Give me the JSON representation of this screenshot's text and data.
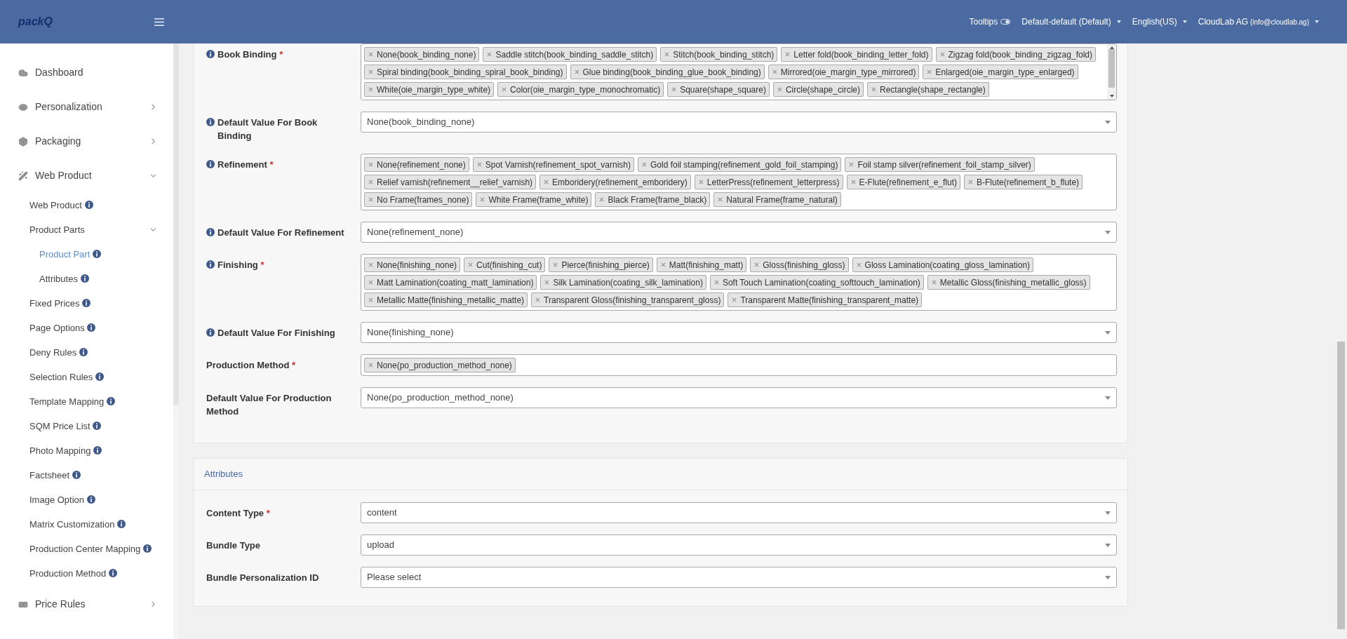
{
  "header": {
    "logo": "packQ",
    "tooltips": "Tooltips",
    "menus": [
      {
        "label": "Default-default (Default)"
      },
      {
        "label": "English(US)"
      },
      {
        "label": "CloudLab AG",
        "note": "(info@cloudlab.ag)"
      }
    ]
  },
  "sidebar": {
    "items": [
      {
        "label": "Dashboard"
      },
      {
        "label": "Personalization",
        "expanded": false
      },
      {
        "label": "Packaging",
        "expanded": false
      },
      {
        "label": "Web Product",
        "expanded": true,
        "children": [
          {
            "label": "Web Product",
            "selected": false
          },
          {
            "label": "Product Parts",
            "expanded": true,
            "children": [
              {
                "label": "Product Part",
                "selected": true
              },
              {
                "label": "Attributes",
                "selected": false
              }
            ]
          },
          {
            "label": "Fixed Prices",
            "selected": false
          },
          {
            "label": "Page Options",
            "selected": false
          },
          {
            "label": "Deny Rules",
            "selected": false
          },
          {
            "label": "Selection Rules",
            "selected": false
          },
          {
            "label": "Template Mapping",
            "selected": false
          },
          {
            "label": "SQM Price List",
            "selected": false
          },
          {
            "label": "Photo Mapping",
            "selected": false
          },
          {
            "label": "Factsheet",
            "selected": false
          },
          {
            "label": "Image Option",
            "selected": false
          },
          {
            "label": "Matrix Customization",
            "selected": false
          },
          {
            "label": "Production Center Mapping",
            "selected": false
          },
          {
            "label": "Production Method",
            "selected": false
          }
        ]
      },
      {
        "label": "Price Rules",
        "expanded": false
      }
    ]
  },
  "form": {
    "fields": [
      {
        "kind": "multiselect",
        "label": "Book Binding",
        "info": true,
        "required_mark": "*",
        "scroll": true,
        "tags": [
          "None(book_binding_none)",
          "Saddle stitch(book_binding_saddle_stitch)",
          "Stitch(book_binding_stitch)",
          "Letter fold(book_binding_letter_fold)",
          "Zigzag fold(book_binding_zigzag_fold)",
          "Spiral binding(book_binding_spiral_book_binding)",
          "Glue binding(book_binding_glue_book_binding)",
          "Mirrored(oie_margin_type_mirrored)",
          "Enlarged(oie_margin_type_enlarged)",
          "White(oie_margin_type_white)",
          "Color(oie_margin_type_monochromatic)",
          "Square(shape_square)",
          "Circle(shape_circle)",
          "Rectangle(shape_rectangle)"
        ]
      },
      {
        "kind": "select",
        "label": "Default Value For Book Binding",
        "info": true,
        "value": "None(book_binding_none)"
      },
      {
        "kind": "multiselect",
        "label": "Refinement",
        "info": true,
        "required_mark": "*",
        "tags": [
          "None(refinement_none)",
          "Spot Varnish(refinement_spot_varnish)",
          "Gold foil stamping(refinement_gold_foil_stamping)",
          "Foil stamp silver(refinement_foil_stamp_silver)",
          "Relief varnish(refinement__relief_varnish)",
          "Emboridery(refinement_emboridery)",
          "LetterPress(refinement_letterpress)",
          "E-Flute(refinement_e_flut)",
          "B-Flute(refinement_b_flute)",
          "No Frame(frames_none)",
          "White Frame(frame_white)",
          "Black Frame(frame_black)",
          "Natural Frame(frame_natural)"
        ]
      },
      {
        "kind": "select",
        "label": "Default Value For Refinement",
        "info": true,
        "value": "None(refinement_none)"
      },
      {
        "kind": "multiselect",
        "label": "Finishing",
        "info": true,
        "required_mark": "*",
        "tags": [
          "None(finishing_none)",
          "Cut(finishing_cut)",
          "Pierce(finishing_pierce)",
          "Matt(finishing_matt)",
          "Gloss(finishing_gloss)",
          "Gloss Lamination(coating_gloss_lamination)",
          "Matt Lamination(coating_matt_lamination)",
          "Silk Lamination(coating_silk_lamination)",
          "Soft Touch Lamination(coating_softtouch_lamination)",
          "Metallic Gloss(finishing_metallic_gloss)",
          "Metallic Matte(finishing_metallic_matte)",
          "Transparent Gloss(finishing_transparent_gloss)",
          "Transparent Matte(finishing_transparent_matte)"
        ]
      },
      {
        "kind": "select",
        "label": "Default Value For Finishing",
        "info": true,
        "value": "None(finishing_none)"
      },
      {
        "kind": "multiselect",
        "label": "Production Method",
        "required_mark": "*",
        "tags": [
          "None(po_production_method_none)"
        ]
      },
      {
        "kind": "select",
        "label": "Default Value For Production Method",
        "value": "None(po_production_method_none)"
      }
    ]
  },
  "attributes": {
    "title": "Attributes",
    "fields": [
      {
        "kind": "select",
        "label": "Content Type",
        "required_mark": "*",
        "value": "content"
      },
      {
        "kind": "select",
        "label": "Bundle Type",
        "value": "upload"
      },
      {
        "kind": "select",
        "label": "Bundle Personalization ID",
        "value": "Please select"
      }
    ]
  }
}
